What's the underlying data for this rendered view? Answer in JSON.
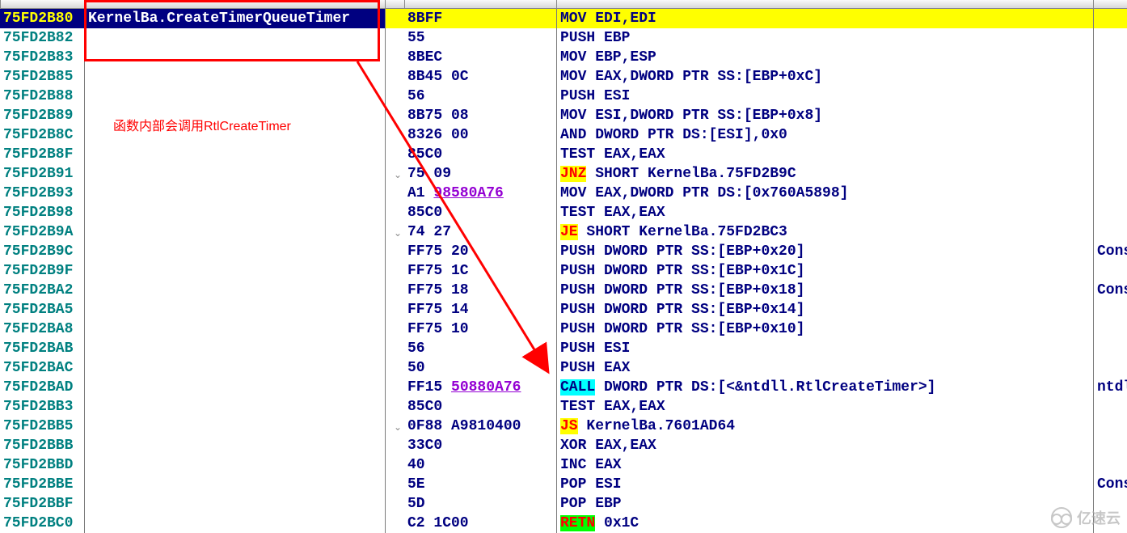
{
  "annotation": {
    "text": "函数内部会调用RtlCreateTimer"
  },
  "watermark": "亿速云",
  "rows": [
    {
      "addr": "75FD2B80",
      "label": "KernelBa.CreateTimerQueueTimer",
      "bytes": "8BFF",
      "disasm": "MOV EDI,EDI",
      "comment": "",
      "sel": true
    },
    {
      "addr": "75FD2B82",
      "label": "",
      "bytes": "55",
      "disasm": "PUSH EBP",
      "comment": ""
    },
    {
      "addr": "75FD2B83",
      "label": "",
      "bytes": "8BEC",
      "disasm": "MOV EBP,ESP",
      "comment": ""
    },
    {
      "addr": "75FD2B85",
      "label": "",
      "bytes": "8B45 0C",
      "disasm": "MOV EAX,DWORD PTR SS:[EBP+0xC]",
      "comment": ""
    },
    {
      "addr": "75FD2B88",
      "label": "",
      "bytes": "56",
      "disasm": "PUSH ESI",
      "comment": ""
    },
    {
      "addr": "75FD2B89",
      "label": "",
      "bytes": "8B75 08",
      "disasm": "MOV ESI,DWORD PTR SS:[EBP+0x8]",
      "comment": ""
    },
    {
      "addr": "75FD2B8C",
      "label": "",
      "bytes": "8326 00",
      "disasm": "AND DWORD PTR DS:[ESI],0x0",
      "comment": ""
    },
    {
      "addr": "75FD2B8F",
      "label": "",
      "bytes": "85C0",
      "disasm": "TEST EAX,EAX",
      "comment": ""
    },
    {
      "addr": "75FD2B91",
      "label": "",
      "bytes": "75 09",
      "disasm": "JNZ SHORT KernelBa.75FD2B9C",
      "comment": "",
      "op": "JNZ",
      "jump": "down"
    },
    {
      "addr": "75FD2B93",
      "label": "",
      "bytes": "A1 <u>98580A76</u>",
      "disasm": "MOV EAX,DWORD PTR DS:[0x760A5898]",
      "comment": ""
    },
    {
      "addr": "75FD2B98",
      "label": "",
      "bytes": "85C0",
      "disasm": "TEST EAX,EAX",
      "comment": ""
    },
    {
      "addr": "75FD2B9A",
      "label": "",
      "bytes": "74 27",
      "disasm": "JE SHORT KernelBa.75FD2BC3",
      "comment": "",
      "op": "JE",
      "jump": "down"
    },
    {
      "addr": "75FD2B9C",
      "label": "",
      "bytes": "FF75 20",
      "disasm": "PUSH DWORD PTR SS:[EBP+0x20]",
      "comment": "Cons"
    },
    {
      "addr": "75FD2B9F",
      "label": "",
      "bytes": "FF75 1C",
      "disasm": "PUSH DWORD PTR SS:[EBP+0x1C]",
      "comment": ""
    },
    {
      "addr": "75FD2BA2",
      "label": "",
      "bytes": "FF75 18",
      "disasm": "PUSH DWORD PTR SS:[EBP+0x18]",
      "comment": "Cons"
    },
    {
      "addr": "75FD2BA5",
      "label": "",
      "bytes": "FF75 14",
      "disasm": "PUSH DWORD PTR SS:[EBP+0x14]",
      "comment": ""
    },
    {
      "addr": "75FD2BA8",
      "label": "",
      "bytes": "FF75 10",
      "disasm": "PUSH DWORD PTR SS:[EBP+0x10]",
      "comment": ""
    },
    {
      "addr": "75FD2BAB",
      "label": "",
      "bytes": "56",
      "disasm": "PUSH ESI",
      "comment": ""
    },
    {
      "addr": "75FD2BAC",
      "label": "",
      "bytes": "50",
      "disasm": "PUSH EAX",
      "comment": ""
    },
    {
      "addr": "75FD2BAD",
      "label": "",
      "bytes": "FF15 <u>50880A76</u>",
      "disasm": "CALL DWORD PTR DS:[<&ntdll.RtlCreateTimer>]",
      "comment": "ntdl",
      "op": "CALL"
    },
    {
      "addr": "75FD2BB3",
      "label": "",
      "bytes": "85C0",
      "disasm": "TEST EAX,EAX",
      "comment": ""
    },
    {
      "addr": "75FD2BB5",
      "label": "",
      "bytes": "0F88 A9810400",
      "disasm": "JS KernelBa.7601AD64",
      "comment": "",
      "op": "JS",
      "jump": "down"
    },
    {
      "addr": "75FD2BBB",
      "label": "",
      "bytes": "33C0",
      "disasm": "XOR EAX,EAX",
      "comment": ""
    },
    {
      "addr": "75FD2BBD",
      "label": "",
      "bytes": "40",
      "disasm": "INC EAX",
      "comment": ""
    },
    {
      "addr": "75FD2BBE",
      "label": "",
      "bytes": "5E",
      "disasm": "POP ESI",
      "comment": "Cons"
    },
    {
      "addr": "75FD2BBF",
      "label": "",
      "bytes": "5D",
      "disasm": "POP EBP",
      "comment": ""
    },
    {
      "addr": "75FD2BC0",
      "label": "",
      "bytes": "C2 1C00",
      "disasm": "RETN 0x1C",
      "comment": "",
      "op": "RETN"
    }
  ]
}
